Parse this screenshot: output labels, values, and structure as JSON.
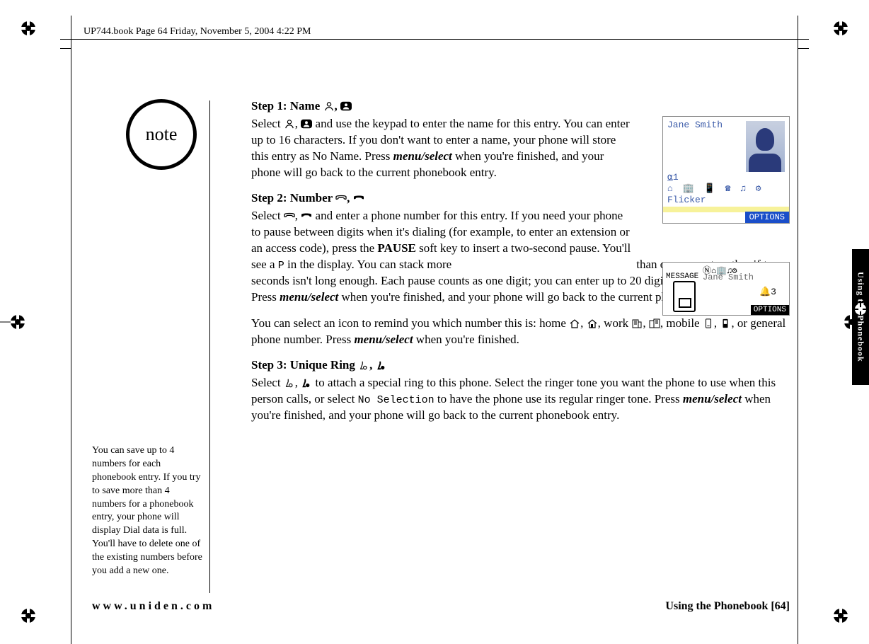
{
  "header": "UP744.book  Page 64  Friday, November 5, 2004  4:22 PM",
  "note_label": "note",
  "side_note": "You can save up to 4 numbers for each phonebook entry. If you try to save more than 4 numbers for a phonebook entry, your phone will display Dial data is full. You'll have to delete one of the existing numbers before you add a new one.",
  "step1": {
    "heading_prefix": "Step 1: Name ",
    "p1a": "Select ",
    "p1b": " and use the keypad to enter the name for this entry. You can enter up to 16 characters. If you don't want to enter a name, your phone will store this entry as No Name. Press ",
    "menuselect": "menu/select",
    "p1c": " when you're finished, and your phone will go back to the current phonebook entry."
  },
  "step2": {
    "heading_prefix": "Step 2: Number ",
    "p1a": "Select ",
    "p1b": " and enter a phone number for this entry. If you need your phone to pause between digits when it's dialing (for example, to enter an extension or an access code), press the ",
    "pause": "PAUSE",
    "p1c": " soft key to insert a two-second pause. You'll see a ",
    "pchar": "P",
    "p1d": " in the display. You can stack more than one pause together if two seconds isn't long enough. Each pause counts as one digit; you can enter up to 20 digits for the phone number. Press ",
    "p1e": " when you're finished, and your phone will go back to the current phonebook entry.",
    "p2a": "You can select an icon to remind you which number this is: home ",
    "p2b": ", work ",
    "p2c": ", mobile ",
    "p2d": ", or general phone number. Press ",
    "p2e": " when you're finished."
  },
  "step3": {
    "heading_prefix": "Step 3: Unique Ring ",
    "p1a": "Select ",
    "p1b": " to attach a special ring to this phone. Select the ringer tone you want the phone to use when this person calls, or select ",
    "nosel": "No Selection",
    "p1c": " to have the phone use its regular ringer tone. Press ",
    "p1d": " when you're finished, and your phone will go back to the current phonebook entry."
  },
  "screen1": {
    "name": "Jane Smith",
    "row1": "⍶1",
    "row2": "⌂ 🏢 📱 ☎ ♫ ⚙",
    "row3": "Flicker",
    "options": "OPTIONS"
  },
  "screen2": {
    "icons": "Ⓝ⌂🏢♫⚙",
    "message": "MESSAGE",
    "name": "Jane Smith",
    "bell": "🔔3",
    "options": "OPTIONS"
  },
  "thumb_tab": "Using the Phonebook",
  "footer": {
    "url": "www.uniden.com",
    "section": "Using the Phonebook [64]"
  }
}
